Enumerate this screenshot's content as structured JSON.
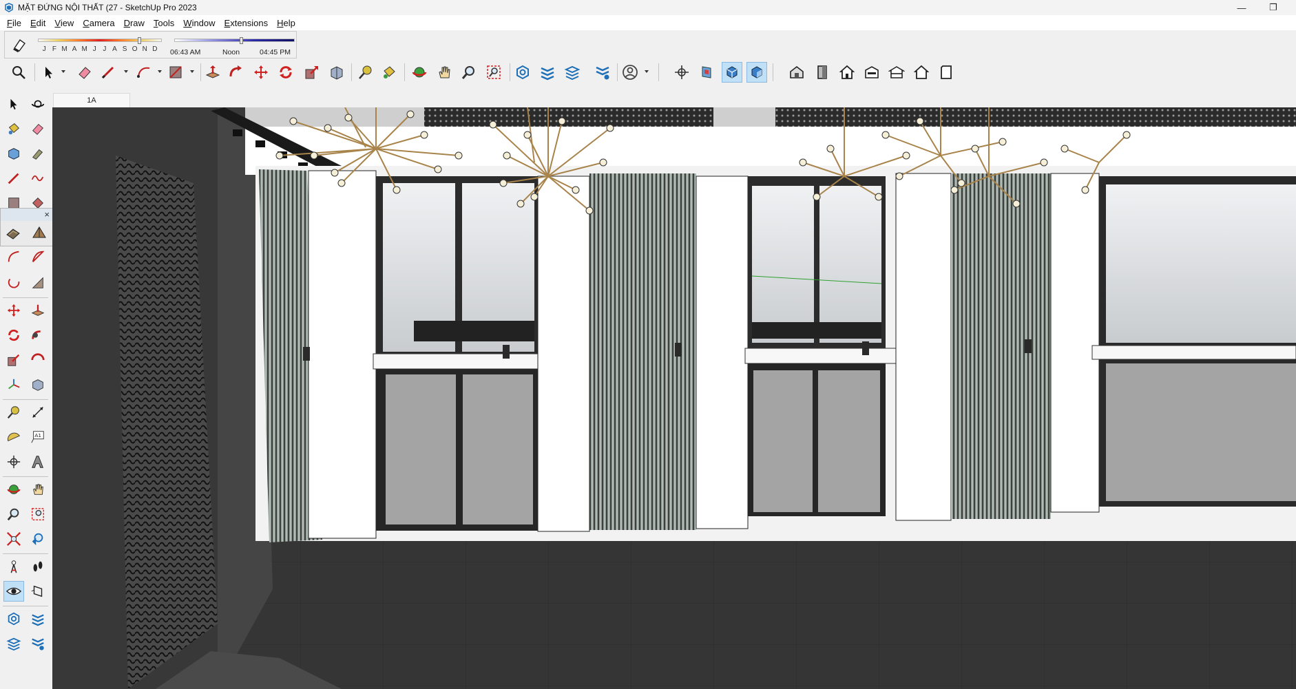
{
  "titlebar": {
    "title": "MẶT ĐỨNG NỘI THẤT (27 - SketchUp Pro 2023",
    "minimize_symbol": "—",
    "restore_symbol": "❐"
  },
  "menu": {
    "items": [
      "File",
      "Edit",
      "View",
      "Camera",
      "Draw",
      "Tools",
      "Window",
      "Extensions",
      "Help"
    ]
  },
  "shadows": {
    "months": [
      "J",
      "F",
      "M",
      "A",
      "M",
      "J",
      "J",
      "A",
      "S",
      "O",
      "N",
      "D"
    ],
    "month_position": 0.83,
    "time_position": 0.56,
    "time_start": "06:43 AM",
    "time_noon": "Noon",
    "time_end": "04:45 PM"
  },
  "main_toolbar": {
    "tools": [
      "zoom-extents-icon",
      "select-icon",
      "eraser-icon",
      "pencil-icon",
      "arc-icon",
      "rectangle-icon",
      "push-pull-icon",
      "follow-me-icon",
      "move-icon",
      "rotate-icon",
      "scale-icon",
      "offset-icon",
      "tape-measure-icon",
      "paint-bucket-icon",
      "orbit-icon",
      "pan-icon",
      "zoom-icon",
      "zoom-window-icon",
      "3d-warehouse-icon",
      "extension-warehouse-icon",
      "layout-icon",
      "extension-manager-icon",
      "profile-icon",
      "section-plane-icon",
      "section-cut-icon",
      "section-fill-icon",
      "section-display-icon",
      "iso-view-icon",
      "top-view-icon",
      "front-view-icon",
      "right-view-icon",
      "back-view-icon",
      "left-view-icon",
      "bottom-view-icon"
    ],
    "active_tools": [
      "front-view-icon",
      "right-view-icon"
    ]
  },
  "left_toolbar": {
    "tools": [
      "select-icon",
      "orbit-icon",
      "paint-bucket-icon",
      "eraser-icon",
      "component-icon",
      "tag-icon",
      "line-icon",
      "freehand-icon",
      "rectangle-icon",
      "rotated-rectangle-icon",
      "arc-icon",
      "pie-icon",
      "move-icon",
      "push-pull-icon",
      "rotate-icon",
      "follow-me-icon",
      "scale-icon",
      "offset-icon",
      "axes-icon",
      "solid-tools-icon",
      "tape-measure-icon",
      "dimension-icon",
      "protractor-icon",
      "text-icon",
      "section-plane-icon",
      "3d-text-icon",
      "orbit-tool-icon",
      "pan-tool-icon",
      "zoom-tool-icon",
      "zoom-window-tool-icon",
      "zoom-extents-tool-icon",
      "previous-view-icon",
      "position-camera-icon",
      "walk-icon",
      "look-around-icon",
      "section-view-icon",
      "section-cut-toggle-icon",
      "section-fill-toggle-icon",
      "section-planes-toggle-icon",
      "section-settings-icon"
    ],
    "active_tool": "look-around-icon",
    "float_close": "×"
  },
  "scene_tabs": [
    "1A"
  ],
  "viewport": {
    "colors": {
      "ceiling_dark": "#2a2a2a",
      "wall_white": "#ffffff",
      "glass": "#d9dbdd",
      "panel_green": "#7e8f86",
      "floor": "#323232",
      "chandelier_gold": "#a8834a"
    }
  }
}
